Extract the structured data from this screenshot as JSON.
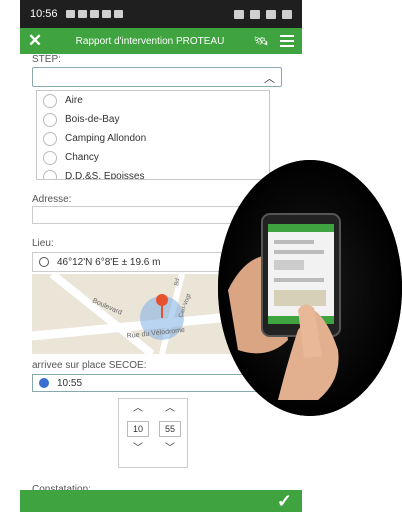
{
  "status_bar": {
    "time": "10:56"
  },
  "app_bar": {
    "title": "Rapport d'intervention PROTEAU"
  },
  "step": {
    "label": "STEP:",
    "options": [
      "Aire",
      "Bois-de-Bay",
      "Camping Allondon",
      "Chancy",
      "D.D.&S. Epoisses"
    ]
  },
  "adresse": {
    "label": "Adresse:",
    "value": ""
  },
  "lieu": {
    "label": "Lieu:",
    "coordinates": "46°12'N 6°8'E ± 19.6 m",
    "map_labels": [
      "Boulevard",
      "Rue du Vélodrome",
      "Carl-Vogt",
      "Bd"
    ]
  },
  "arrivee": {
    "label": "arrivee sur place SECOE:",
    "time_value": "10:55",
    "hour": "10",
    "minute": "55"
  },
  "constatation": {
    "label": "Constatation:"
  },
  "colors": {
    "accent": "#3fa33f",
    "clock": "#3a6fd0"
  }
}
